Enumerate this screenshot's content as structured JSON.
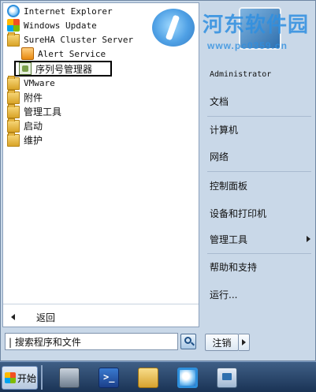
{
  "programs": [
    {
      "name": "internet-explorer",
      "label": "Internet Explorer",
      "icon": "ie-icon"
    },
    {
      "name": "windows-update",
      "label": "Windows Update",
      "icon": "windows-update-icon"
    },
    {
      "name": "sureha-cluster-server",
      "label": "SureHA Cluster Server",
      "icon": "folder-icon"
    },
    {
      "name": "alert-service",
      "label": "Alert Service",
      "icon": "alert-service-icon"
    },
    {
      "name": "serial-manager",
      "label": "序列号管理器",
      "icon": "serial-manager-icon"
    },
    {
      "name": "vmware",
      "label": "VMware",
      "icon": "folder-icon"
    },
    {
      "name": "accessories",
      "label": "附件",
      "icon": "folder-icon"
    },
    {
      "name": "admin-tools",
      "label": "管理工具",
      "icon": "folder-icon"
    },
    {
      "name": "startup",
      "label": "启动",
      "icon": "folder-icon"
    },
    {
      "name": "maintenance",
      "label": "维护",
      "icon": "folder-icon"
    }
  ],
  "back_label": "返回",
  "right_menu": {
    "user": "Administrator",
    "documents": "文档",
    "computer": "计算机",
    "network": "网络",
    "control_panel": "控制面板",
    "devices_printers": "设备和打印机",
    "admin_tools": "管理工具",
    "help_support": "帮助和支持",
    "run": "运行..."
  },
  "search": {
    "value": "搜索程序和文件"
  },
  "logout_label": "注销",
  "start_label": "开始",
  "taskbar": [
    {
      "name": "server-manager-icon"
    },
    {
      "name": "powershell-icon"
    },
    {
      "name": "explorer-icon"
    },
    {
      "name": "ie-icon"
    },
    {
      "name": "network-icon"
    }
  ],
  "watermark": {
    "title": "河东软件园",
    "url": "www.pc0359.cn"
  },
  "colors": {
    "menu_bg": "#c9d8e8",
    "taskbar": "#1a3355",
    "watermark": "#2f8fe0"
  }
}
